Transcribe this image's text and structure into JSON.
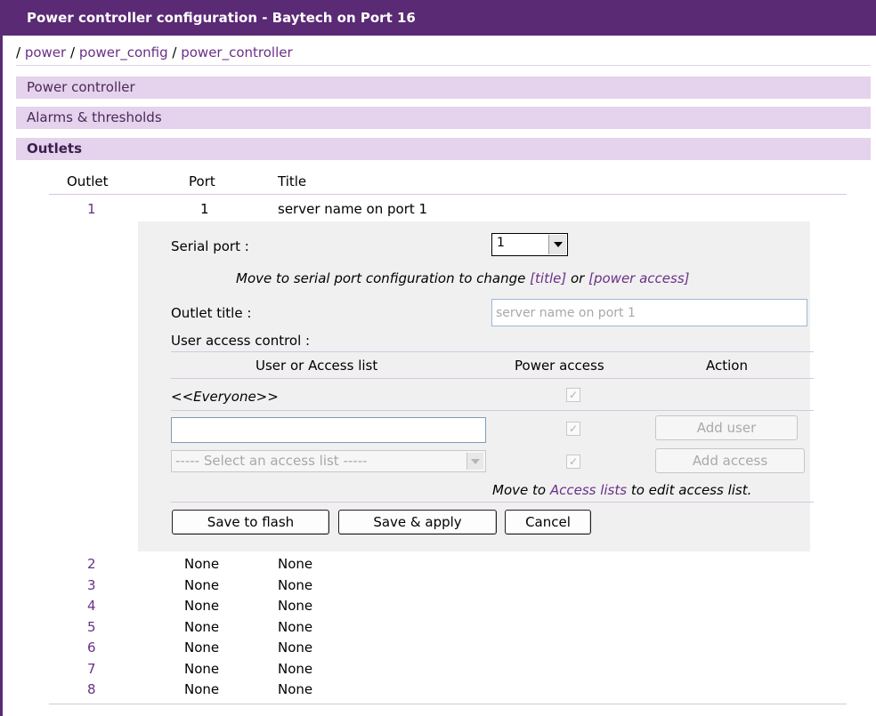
{
  "header": {
    "title": "Power controller configuration - Baytech on Port 16"
  },
  "breadcrumb": {
    "sep": "/",
    "items": [
      "power",
      "power_config",
      "power_controller"
    ]
  },
  "sections": {
    "power_controller": "Power controller",
    "alarms": "Alarms & thresholds",
    "outlets": "Outlets"
  },
  "outlets_table": {
    "columns": [
      "Outlet",
      "Port",
      "Title"
    ],
    "rows": [
      {
        "outlet": "1",
        "port": "1",
        "title": "server name on port 1"
      },
      {
        "outlet": "2",
        "port": "None",
        "title": "None"
      },
      {
        "outlet": "3",
        "port": "None",
        "title": "None"
      },
      {
        "outlet": "4",
        "port": "None",
        "title": "None"
      },
      {
        "outlet": "5",
        "port": "None",
        "title": "None"
      },
      {
        "outlet": "6",
        "port": "None",
        "title": "None"
      },
      {
        "outlet": "7",
        "port": "None",
        "title": "None"
      },
      {
        "outlet": "8",
        "port": "None",
        "title": "None"
      }
    ]
  },
  "panel": {
    "serial_port_label": "Serial port :",
    "serial_port_value": "1",
    "move_note_prefix": "Move to serial port configuration to change",
    "title_link": "[title]",
    "or_text": "or",
    "power_access_link": "[power access]",
    "outlet_title_label": "Outlet title :",
    "outlet_title_value": "server name on port 1",
    "user_access_label": "User access control :",
    "access_columns": [
      "User or Access list",
      "Power access",
      "Action"
    ],
    "everyone_label": "<<Everyone>>",
    "user_input_value": "",
    "access_list_select": "----- Select an access list -----",
    "add_user": "Add user",
    "add_access": "Add access",
    "move_to": "Move to",
    "access_lists_link": "Access lists",
    "edit_note": "to edit access list.",
    "save_flash": "Save to flash",
    "save_apply": "Save & apply",
    "cancel": "Cancel"
  },
  "colors": {
    "titlebar": "#5a2a74",
    "section_bar": "#e5d2ec",
    "link": "#6a2f88",
    "panel_bg": "#f0f0f0"
  }
}
